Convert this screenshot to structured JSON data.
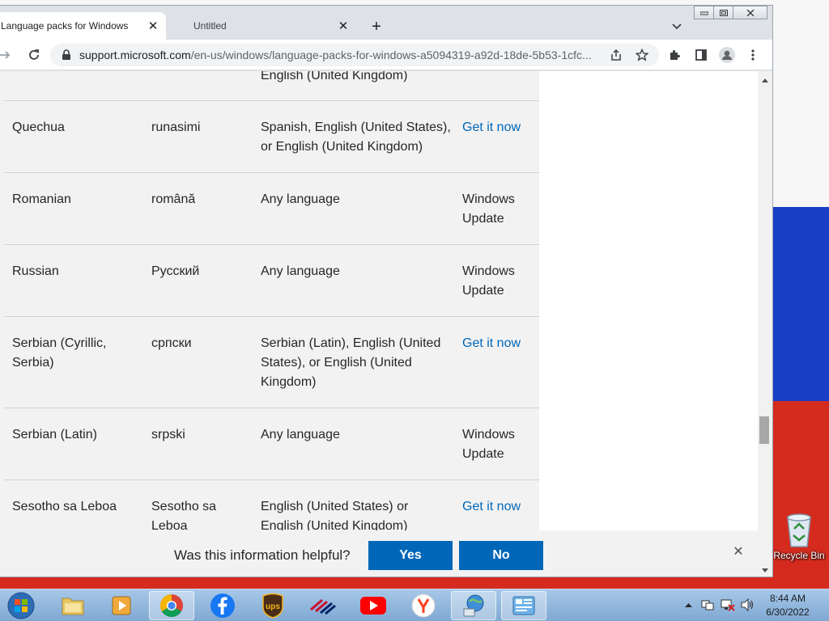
{
  "browser": {
    "tabs": [
      {
        "title": "Language packs for Windows",
        "active": true
      },
      {
        "title": "Untitled",
        "active": false
      }
    ],
    "url_host": "support.microsoft.com",
    "url_path": "/en-us/windows/language-packs-for-windows-a5094319-a92d-18de-5b53-1cfc..."
  },
  "table": {
    "partial_top": {
      "c3": "English (United Kingdom)"
    },
    "rows": [
      {
        "language": "Quechua",
        "native": "runasimi",
        "base": "Spanish, English (United States), or English (United Kingdom)",
        "action": "Get it now",
        "link": true
      },
      {
        "language": "Romanian",
        "native": "română",
        "base": "Any language",
        "action": "Windows Update",
        "link": false
      },
      {
        "language": "Russian",
        "native": "Русский",
        "base": "Any language",
        "action": "Windows Update",
        "link": false
      },
      {
        "language": "Serbian (Cyrillic, Serbia)",
        "native": "српски",
        "base": "Serbian (Latin), English (United States), or English (United Kingdom)",
        "action": "Get it now",
        "link": true
      },
      {
        "language": "Serbian (Latin)",
        "native": "srpski",
        "base": "Any language",
        "action": "Windows Update",
        "link": false
      },
      {
        "language": "Sesotho sa Leboa",
        "native": "Sesotho sa Leboa",
        "base": "English (United States) or English (United Kingdom)",
        "action": "Get it now",
        "link": true
      }
    ]
  },
  "feedback": {
    "question": "Was this information helpful?",
    "yes": "Yes",
    "no": "No"
  },
  "desktop": {
    "recycle_bin_label": "Recycle Bin"
  },
  "taskbar": {
    "time": "8:44 AM",
    "date": "6/30/2022"
  },
  "colors": {
    "link": "#0067b8",
    "button": "#0067b8",
    "flag_white": "#f7f7f7",
    "flag_blue": "#1a3fc6",
    "flag_red": "#d52b1e"
  }
}
